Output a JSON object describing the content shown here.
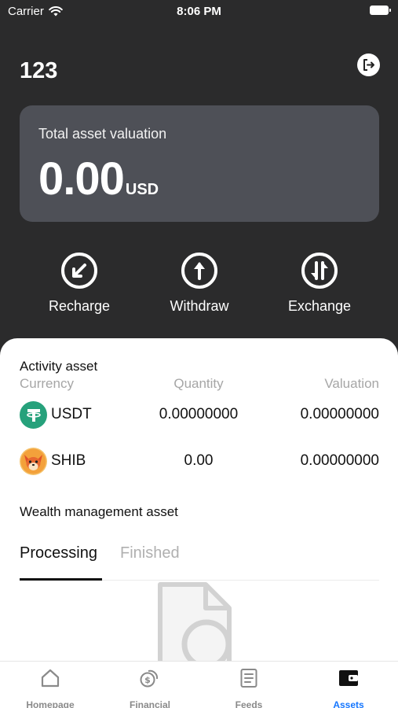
{
  "status_bar": {
    "carrier": "Carrier",
    "time": "8:06 PM"
  },
  "header": {
    "user_name": "123"
  },
  "asset_card": {
    "label": "Total asset valuation",
    "amount": "0.00",
    "unit": "USD"
  },
  "actions": [
    {
      "label": "Recharge",
      "icon": "recharge-icon"
    },
    {
      "label": "Withdraw",
      "icon": "withdraw-icon"
    },
    {
      "label": "Exchange",
      "icon": "exchange-icon"
    }
  ],
  "activity": {
    "title": "Activity asset",
    "columns": [
      "Currency",
      "Quantity",
      "Valuation"
    ],
    "rows": [
      {
        "currency": "USDT",
        "quantity": "0.00000000",
        "valuation": "0.00000000",
        "icon": "usdt-icon",
        "color": "#26a17b"
      },
      {
        "currency": "SHIB",
        "quantity": "0.00",
        "valuation": "0.00000000",
        "icon": "shib-icon",
        "color": "#e0502a"
      }
    ]
  },
  "wealth": {
    "title": "Wealth management asset",
    "tabs": [
      {
        "label": "Processing",
        "active": true
      },
      {
        "label": "Finished",
        "active": false
      }
    ]
  },
  "tab_bar": [
    {
      "label": "Homepage",
      "icon": "home-icon",
      "selected": false
    },
    {
      "label": "Financial",
      "icon": "financial-icon",
      "selected": false
    },
    {
      "label": "Feeds",
      "icon": "feeds-icon",
      "selected": false
    },
    {
      "label": "Assets",
      "icon": "wallet-icon",
      "selected": true
    }
  ],
  "colors": {
    "background": "#2b2b2c",
    "card": "#4e5057",
    "accent": "#1677ff"
  }
}
